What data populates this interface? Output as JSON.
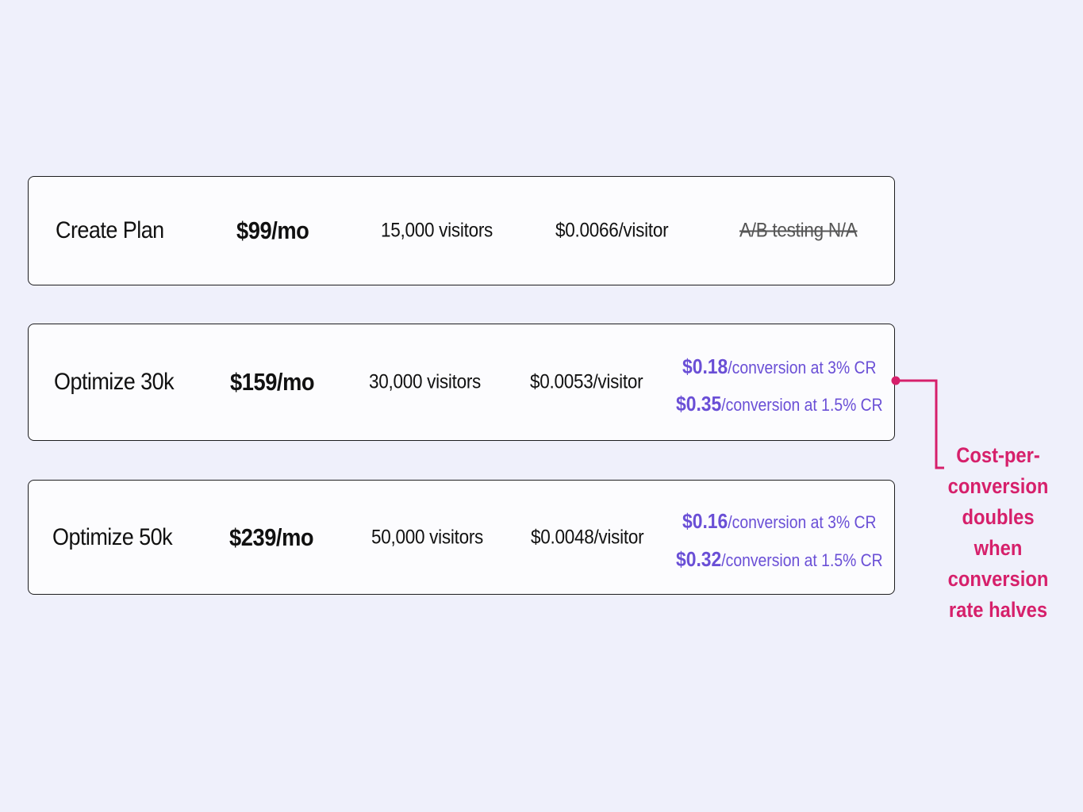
{
  "colors": {
    "background": "#eff0fb",
    "card_border": "#1d1d1f",
    "conversion_text": "#6a4fd6",
    "callout_accent": "#d6206b",
    "strikethrough_text": "#555555"
  },
  "plans": [
    {
      "name": "Create Plan",
      "price": "$99/mo",
      "visitors": "15,000 visitors",
      "per_visitor": "$0.0066/visitor",
      "ab_testing": "A/B testing N/A"
    },
    {
      "name": "Optimize 30k",
      "price": "$159/mo",
      "visitors": "30,000 visitors",
      "per_visitor": "$0.0053/visitor",
      "conversions": [
        {
          "amount": "$0.18",
          "suffix": "/conversion at 3% CR"
        },
        {
          "amount": "$0.35",
          "suffix": "/conversion at 1.5% CR"
        }
      ]
    },
    {
      "name": "Optimize 50k",
      "price": "$239/mo",
      "visitors": "50,000 visitors",
      "per_visitor": "$0.0048/visitor",
      "conversions": [
        {
          "amount": "$0.16",
          "suffix": "/conversion at 3% CR"
        },
        {
          "amount": "$0.32",
          "suffix": "/conversion at 1.5% CR"
        }
      ]
    }
  ],
  "callout": {
    "lines": [
      "Cost-per-",
      "conversion",
      "doubles when",
      "conversion",
      "rate halves"
    ]
  }
}
